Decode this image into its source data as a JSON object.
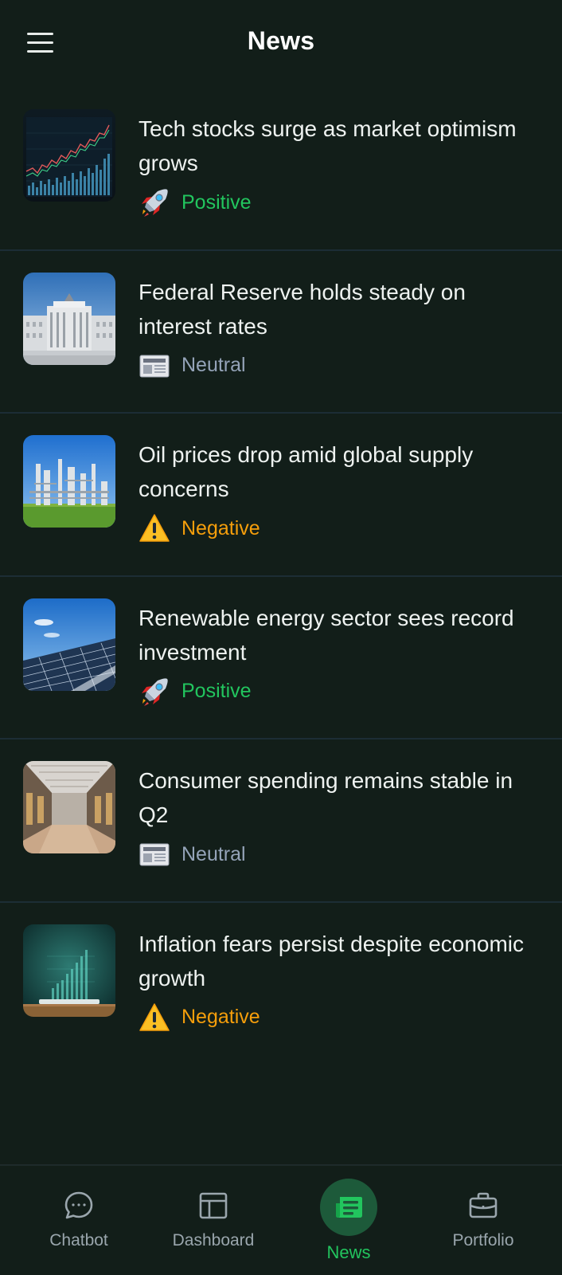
{
  "header": {
    "title": "News",
    "menu_icon": "menu-icon"
  },
  "articles": [
    {
      "headline": "Tech stocks surge as market optimism grows",
      "thumbnail": "stock-chart-image",
      "sentiment": {
        "label": "Positive",
        "icon": "rocket-icon",
        "color": "#22c55e"
      }
    },
    {
      "headline": "Federal Reserve holds steady on interest rates",
      "thumbnail": "federal-reserve-building-image",
      "sentiment": {
        "label": "Neutral",
        "icon": "newspaper-icon",
        "color": "#94a3b8"
      }
    },
    {
      "headline": "Oil prices drop amid global supply concerns",
      "thumbnail": "oil-refinery-image",
      "sentiment": {
        "label": "Negative",
        "icon": "warning-icon",
        "color": "#f59e0b"
      }
    },
    {
      "headline": "Renewable energy sector sees record investment",
      "thumbnail": "solar-panels-image",
      "sentiment": {
        "label": "Positive",
        "icon": "rocket-icon",
        "color": "#22c55e"
      }
    },
    {
      "headline": "Consumer spending remains stable in Q2",
      "thumbnail": "shopping-mall-image",
      "sentiment": {
        "label": "Neutral",
        "icon": "newspaper-icon",
        "color": "#94a3b8"
      }
    },
    {
      "headline": "Inflation fears persist despite economic growth",
      "thumbnail": "tablet-chart-image",
      "sentiment": {
        "label": "Negative",
        "icon": "warning-icon",
        "color": "#f59e0b"
      }
    }
  ],
  "bottom_nav": {
    "items": [
      {
        "label": "Chatbot",
        "icon": "chat-bubble-icon",
        "active": false
      },
      {
        "label": "Dashboard",
        "icon": "dashboard-layout-icon",
        "active": false
      },
      {
        "label": "News",
        "icon": "newspaper-icon",
        "active": true
      },
      {
        "label": "Portfolio",
        "icon": "briefcase-icon",
        "active": false
      }
    ],
    "active_color": "#22c55e",
    "inactive_color": "#9aa6ad"
  },
  "colors": {
    "background": "#121e19",
    "divider": "#1c2d35",
    "positive": "#22c55e",
    "neutral": "#94a3b8",
    "negative": "#f59e0b"
  }
}
